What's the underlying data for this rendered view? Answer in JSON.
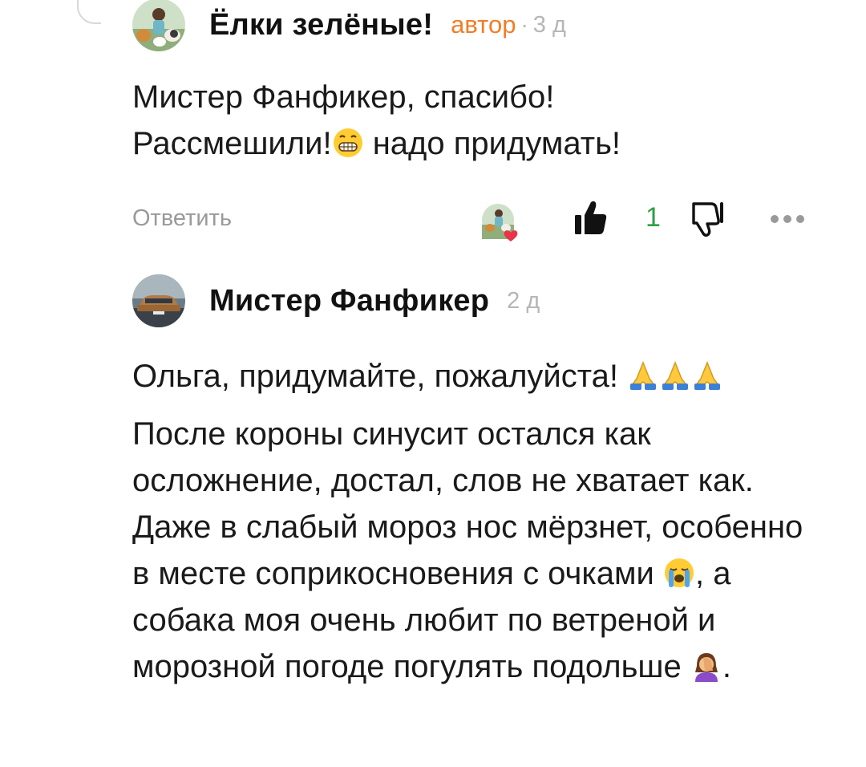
{
  "comments": [
    {
      "author": "Ёлки зелёные!",
      "badge": "автор",
      "separator": "·",
      "time": "3 д",
      "avatar": "author-avatar-dogs",
      "lines": [
        "Мистер Фанфикер, спасибо!",
        "Рассмешили!",
        "надо придумать!"
      ],
      "emoji": [
        "grinning-face-icon"
      ],
      "actions": {
        "reply_label": "Ответить",
        "like_count": "1",
        "liked_by_author_avatar": "liked-by-author-icon"
      }
    },
    {
      "author": "Мистер Фанфикер",
      "time": "2 д",
      "avatar": "car-avatar",
      "paragraph1": "Ольга, придумайте, пожалуйста!",
      "paragraph2_parts": [
        "После короны синусит остался как осложнение, достал, слов не хватает как. Даже в слабый мороз нос мёрзнет, особенно в месте соприкосновения с очками",
        ", а собака моя очень любит по ветреной и морозной погоде погулять подольше",
        "."
      ],
      "emoji": [
        "folded-hands-icon",
        "loudly-crying-face-icon",
        "face-palm-icon"
      ]
    }
  ],
  "colors": {
    "badge": "#f07d28",
    "like_count": "#2ea043",
    "muted": "#9a9a9a"
  }
}
